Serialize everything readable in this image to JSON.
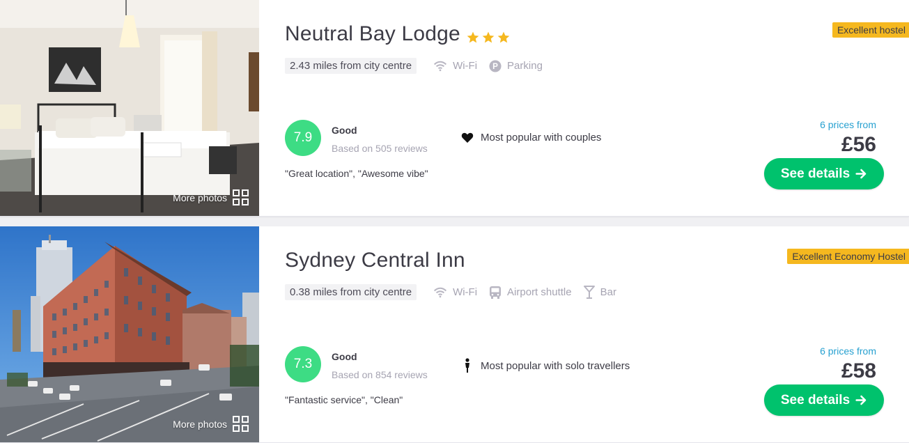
{
  "colors": {
    "score": "#3ddc84",
    "button": "#00c26d",
    "badge": "#f5b81f",
    "prices_link": "#26a0d0",
    "star": "#f5b81f"
  },
  "listings": [
    {
      "name": "Neutral Bay Lodge",
      "stars": 3,
      "badge": "Excellent hostel",
      "distance": "2.43 miles from city centre",
      "facilities": [
        {
          "icon": "wifi-icon",
          "label": "Wi-Fi"
        },
        {
          "icon": "parking-icon",
          "label": "Parking"
        }
      ],
      "score": "7.9",
      "rating_word": "Good",
      "reviews": "Based on 505 reviews",
      "popular_icon": "heart-icon",
      "popular": "Most popular with couples",
      "quote": "\"Great location\", \"Awesome vibe\"",
      "prices_from": "6 prices from",
      "price": "£56",
      "button": "See details",
      "more_photos": "More photos"
    },
    {
      "name": "Sydney Central Inn",
      "stars": 0,
      "badge": "Excellent Economy Hostel",
      "distance": "0.38 miles from city centre",
      "facilities": [
        {
          "icon": "wifi-icon",
          "label": "Wi-Fi"
        },
        {
          "icon": "bus-icon",
          "label": "Airport shuttle"
        },
        {
          "icon": "cocktail-icon",
          "label": "Bar"
        }
      ],
      "score": "7.3",
      "rating_word": "Good",
      "reviews": "Based on 854 reviews",
      "popular_icon": "solo-traveller-icon",
      "popular": "Most popular with solo travellers",
      "quote": "\"Fantastic service\", \"Clean\"",
      "prices_from": "6 prices from",
      "price": "£58",
      "button": "See details",
      "more_photos": "More photos"
    }
  ]
}
